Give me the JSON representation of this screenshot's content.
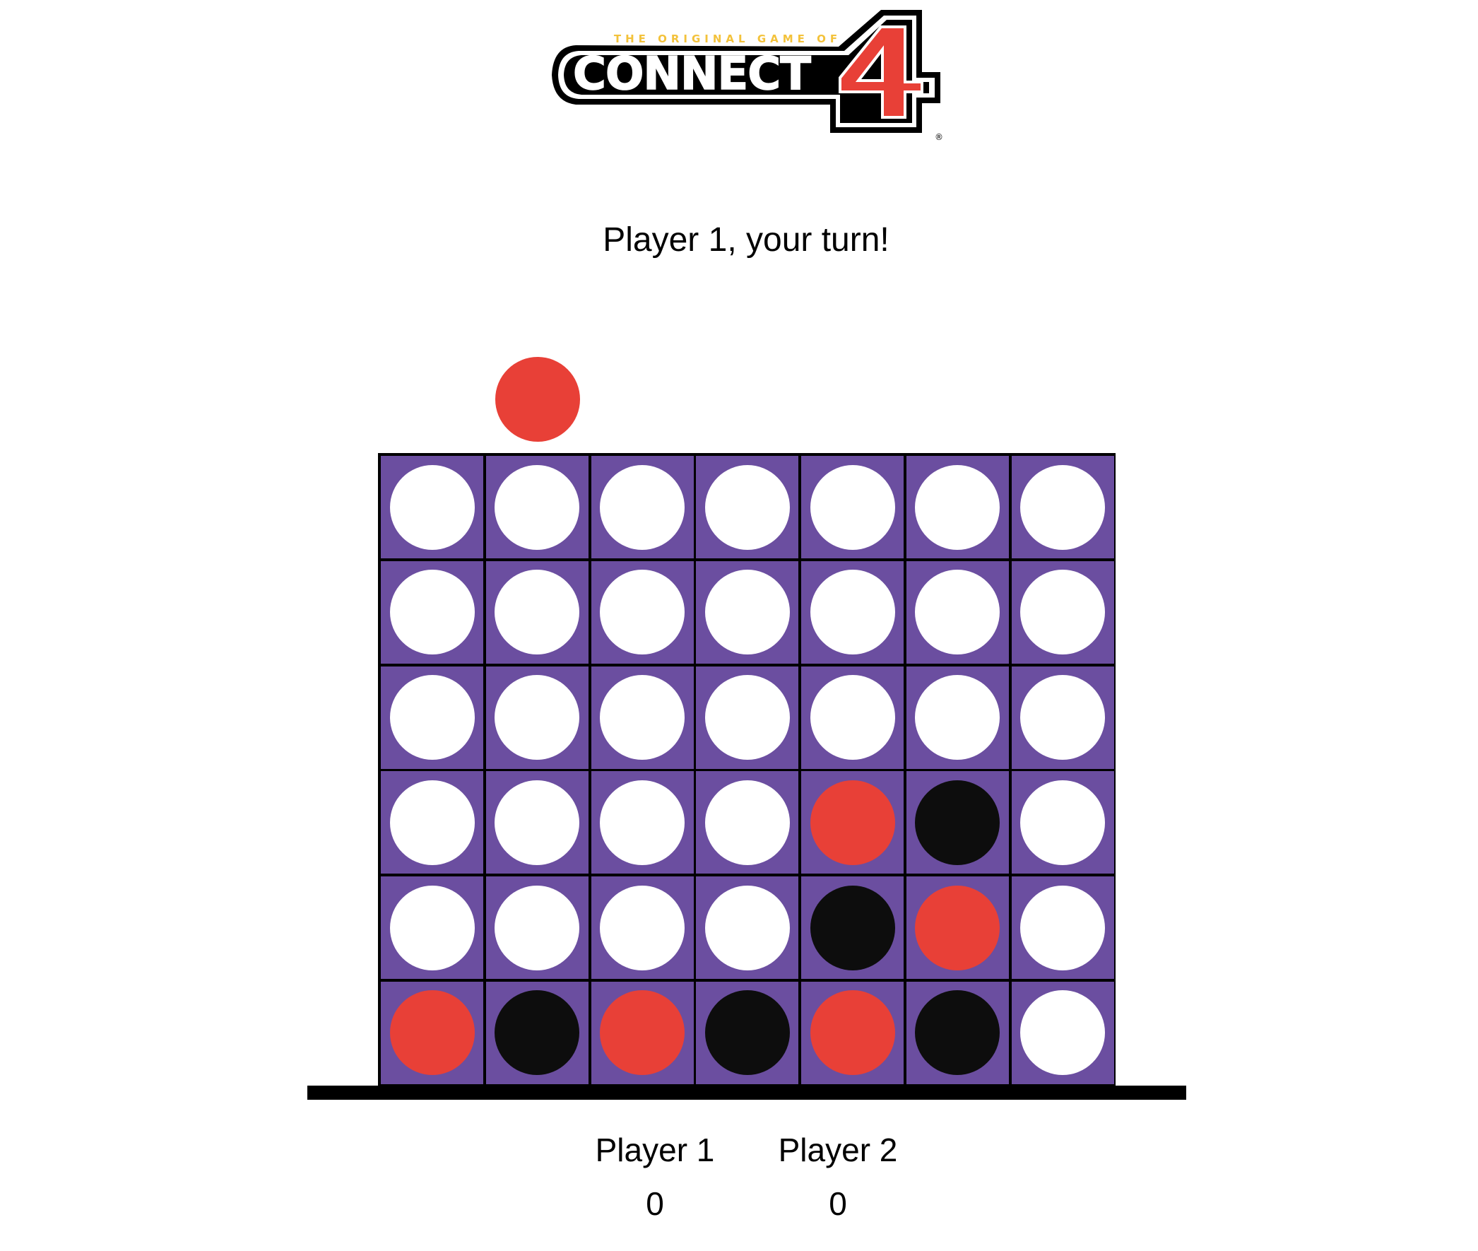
{
  "logo": {
    "tagline": "THE ORIGINAL GAME OF",
    "wordmark": "CONNECT",
    "number": "4",
    "registered": "®"
  },
  "status": "Player 1, your turn!",
  "colors": {
    "board": "#6b4ea0",
    "empty": "#ffffff",
    "red": "#e84037",
    "black": "#0d0d0d"
  },
  "game": {
    "columns": 7,
    "rows": 6,
    "hover_piece": {
      "color": "red",
      "column": 2
    },
    "grid": [
      [
        "empty",
        "empty",
        "empty",
        "empty",
        "empty",
        "empty",
        "empty"
      ],
      [
        "empty",
        "empty",
        "empty",
        "empty",
        "empty",
        "empty",
        "empty"
      ],
      [
        "empty",
        "empty",
        "empty",
        "empty",
        "empty",
        "empty",
        "empty"
      ],
      [
        "empty",
        "empty",
        "empty",
        "empty",
        "red",
        "black",
        "empty"
      ],
      [
        "empty",
        "empty",
        "empty",
        "empty",
        "black",
        "red",
        "empty"
      ],
      [
        "red",
        "black",
        "red",
        "black",
        "red",
        "black",
        "empty"
      ]
    ]
  },
  "scores": {
    "player1": {
      "label": "Player 1",
      "score": "0"
    },
    "player2": {
      "label": "Player 2",
      "score": "0"
    }
  }
}
